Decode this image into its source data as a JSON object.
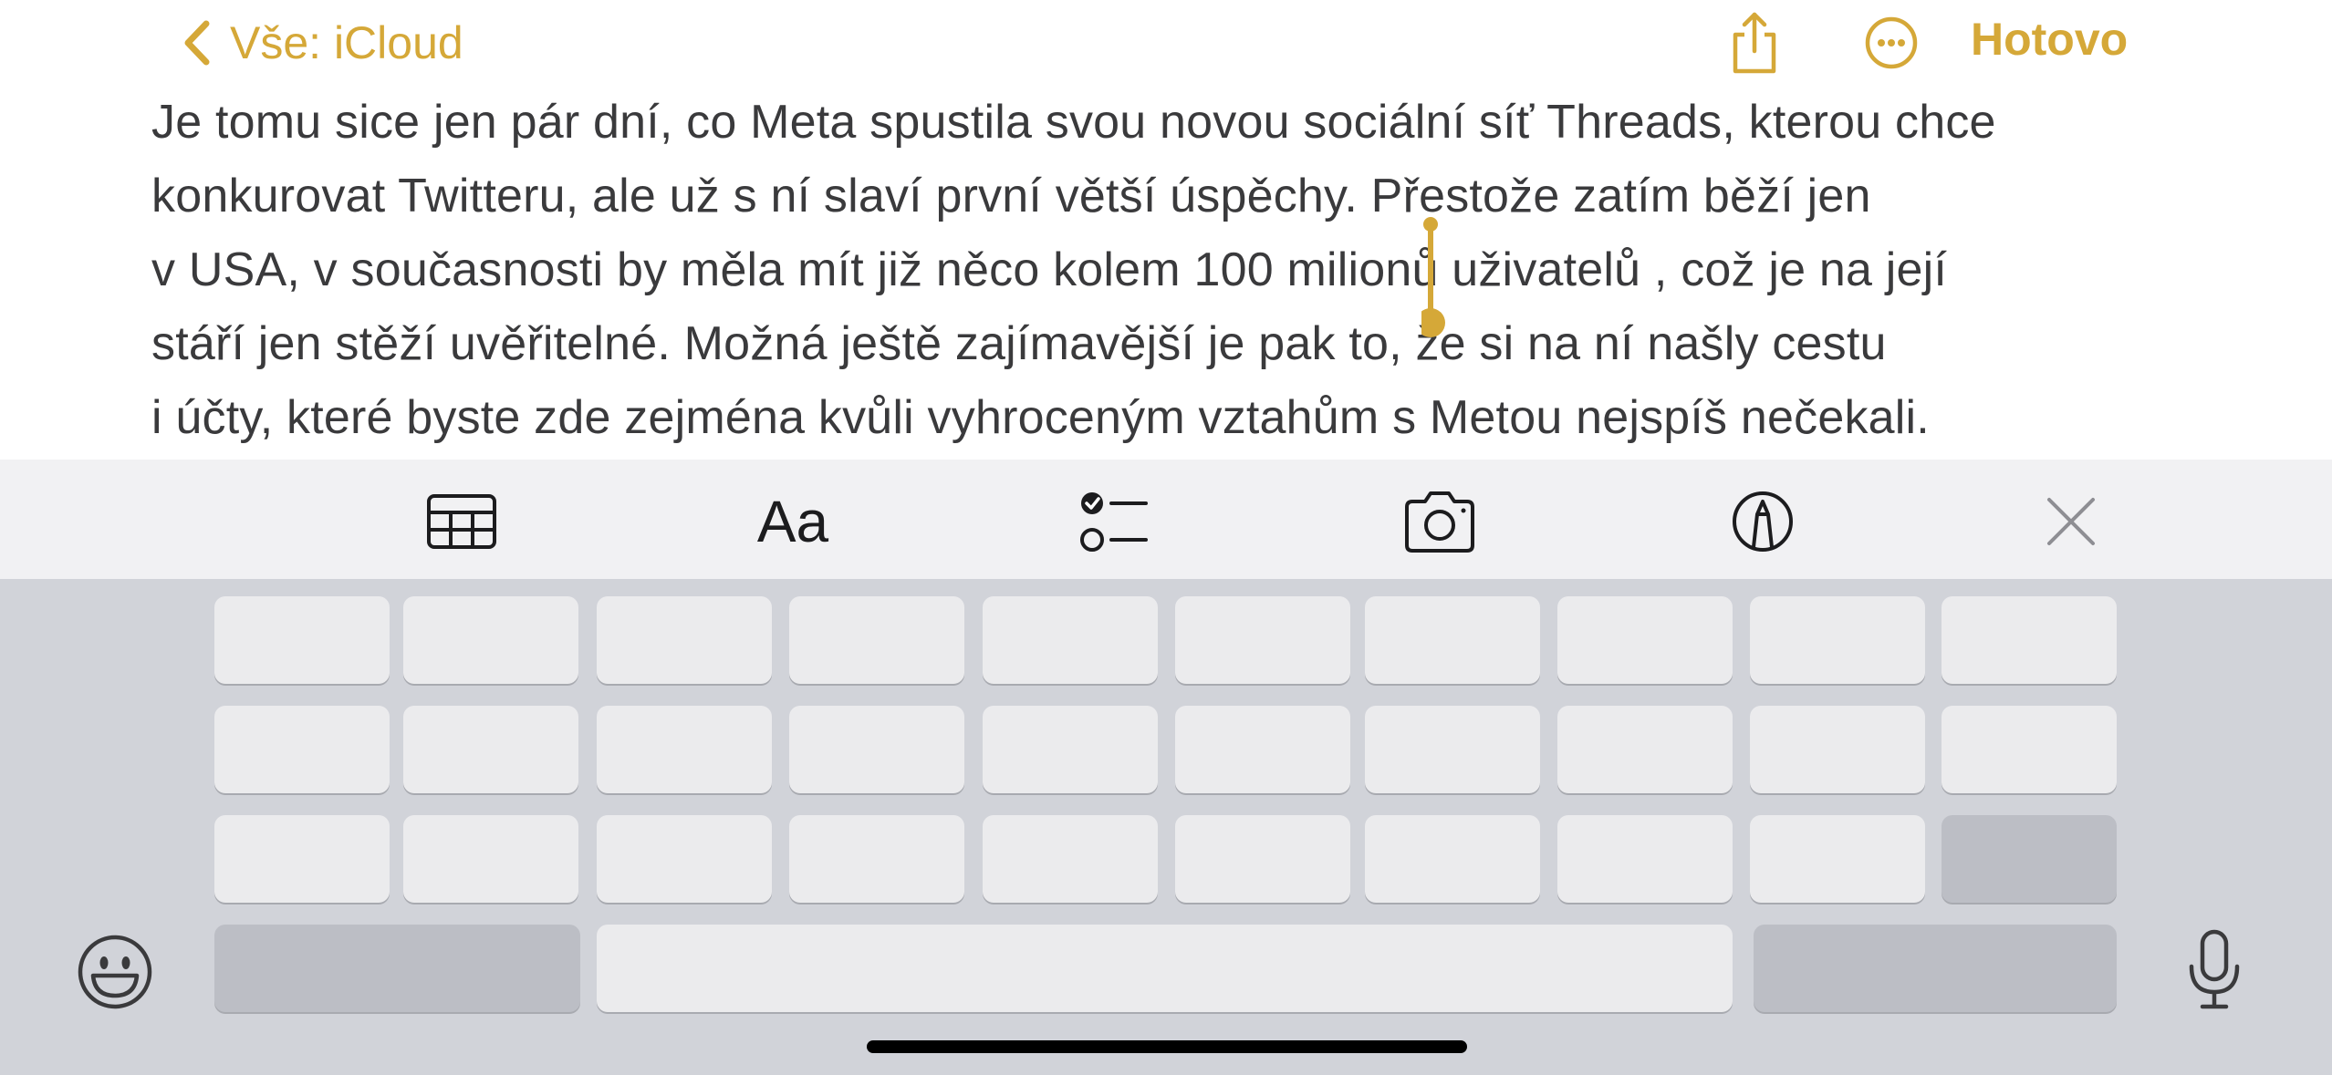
{
  "nav": {
    "back_label": "Vše: iCloud",
    "done_label": "Hotovo",
    "accent_color": "#D5A838",
    "icons": [
      "chevron-left-icon",
      "share-icon",
      "ellipsis-circle-icon"
    ]
  },
  "note": {
    "lines": [
      "Je tomu sice jen pár dní, co Meta spustila svou novou sociální síť Threads, kterou chce",
      "konkurovat Twitteru, ale už s ní slaví první větší úspěchy. Přestože zatím běží jen",
      "v USA, v současnosti by měla mít již něco kolem 100 milionů uživatelů , což je na její",
      "stáří jen stěží uvěřitelné. Možná ještě zajímavější je pak to, že si na ní našly cestu",
      "i účty, které byste zde zejména kvůli vyhroceným vztahům s Metou nejspíš nečekali."
    ]
  },
  "toolbar": {
    "format_label": "Aa",
    "icons": [
      "table-icon",
      "format-icon",
      "checklist-icon",
      "camera-icon",
      "markup-pen-icon",
      "close-icon"
    ]
  },
  "keyboard": {
    "rows": 4,
    "icons": [
      "emoji-icon",
      "microphone-icon"
    ]
  }
}
